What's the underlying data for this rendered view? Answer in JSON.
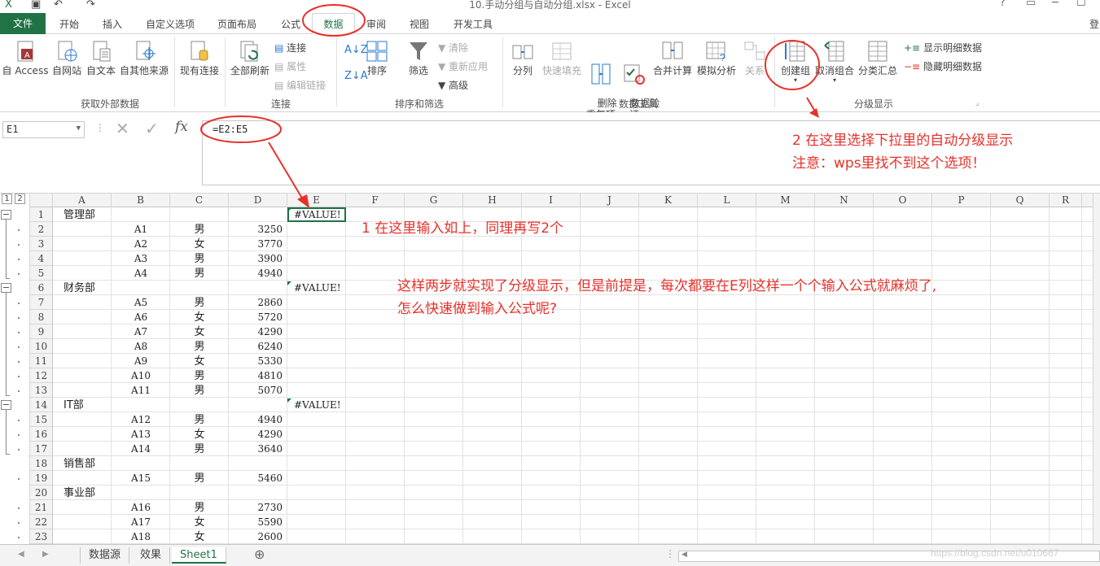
{
  "window": {
    "title": "10.手动分组与自动分组.xlsx - Excel",
    "signin": "登"
  },
  "tabs": {
    "file": "文件",
    "items": [
      "开始",
      "插入",
      "自定义选项",
      "页面布局",
      "公式",
      "数据",
      "审阅",
      "视图",
      "开发工具"
    ],
    "active": "数据"
  },
  "ribbon": {
    "external_data": {
      "buttons": [
        "自 Access",
        "自网站",
        "自文本",
        "自其他来源",
        "现有连接"
      ],
      "label": "获取外部数据"
    },
    "connections": {
      "refresh_all": "全部刷新",
      "small": [
        "连接",
        "属性",
        "编辑链接"
      ],
      "label": "连接"
    },
    "sort_filter": {
      "sort": "排序",
      "filter": "筛选",
      "small": [
        "清除",
        "重新应用",
        "高级"
      ],
      "label": "排序和筛选"
    },
    "data_tools": {
      "buttons": [
        "分列",
        "快速填充",
        "删除\n重复项",
        "数据验\n证",
        "合并计算",
        "模拟分析",
        "关系"
      ],
      "label": "数据工具"
    },
    "outline": {
      "buttons": [
        "创建组",
        "取消组合",
        "分类汇总"
      ],
      "small": [
        "显示明细数据",
        "隐藏明细数据"
      ],
      "label": "分级显示"
    }
  },
  "formula_bar": {
    "name_box": "E1",
    "formula": "=E2:E5",
    "fx": "fx"
  },
  "outline_levels": [
    "1",
    "2"
  ],
  "columns": [
    "A",
    "B",
    "C",
    "D",
    "E",
    "F",
    "G",
    "H",
    "I",
    "J",
    "K",
    "L",
    "M",
    "N",
    "O",
    "P",
    "Q",
    "R"
  ],
  "rows": [
    {
      "n": "1",
      "a": "管理部",
      "b": "",
      "c": "",
      "d": "",
      "e": "#VALUE!"
    },
    {
      "n": "2",
      "a": "",
      "b": "A1",
      "c": "男",
      "d": "3250",
      "e": ""
    },
    {
      "n": "3",
      "a": "",
      "b": "A2",
      "c": "女",
      "d": "3770",
      "e": ""
    },
    {
      "n": "4",
      "a": "",
      "b": "A3",
      "c": "男",
      "d": "3900",
      "e": ""
    },
    {
      "n": "5",
      "a": "",
      "b": "A4",
      "c": "男",
      "d": "4940",
      "e": ""
    },
    {
      "n": "6",
      "a": "财务部",
      "b": "",
      "c": "",
      "d": "",
      "e": "#VALUE!"
    },
    {
      "n": "7",
      "a": "",
      "b": "A5",
      "c": "男",
      "d": "2860",
      "e": ""
    },
    {
      "n": "8",
      "a": "",
      "b": "A6",
      "c": "女",
      "d": "5720",
      "e": ""
    },
    {
      "n": "9",
      "a": "",
      "b": "A7",
      "c": "女",
      "d": "4290",
      "e": ""
    },
    {
      "n": "10",
      "a": "",
      "b": "A8",
      "c": "男",
      "d": "6240",
      "e": ""
    },
    {
      "n": "11",
      "a": "",
      "b": "A9",
      "c": "女",
      "d": "5330",
      "e": ""
    },
    {
      "n": "12",
      "a": "",
      "b": "A10",
      "c": "男",
      "d": "4810",
      "e": ""
    },
    {
      "n": "13",
      "a": "",
      "b": "A11",
      "c": "男",
      "d": "5070",
      "e": ""
    },
    {
      "n": "14",
      "a": "IT部",
      "b": "",
      "c": "",
      "d": "",
      "e": "#VALUE!"
    },
    {
      "n": "15",
      "a": "",
      "b": "A12",
      "c": "男",
      "d": "4940",
      "e": ""
    },
    {
      "n": "16",
      "a": "",
      "b": "A13",
      "c": "女",
      "d": "4290",
      "e": ""
    },
    {
      "n": "17",
      "a": "",
      "b": "A14",
      "c": "男",
      "d": "3640",
      "e": ""
    },
    {
      "n": "18",
      "a": "销售部",
      "b": "",
      "c": "",
      "d": "",
      "e": ""
    },
    {
      "n": "19",
      "a": "",
      "b": "A15",
      "c": "男",
      "d": "5460",
      "e": ""
    },
    {
      "n": "20",
      "a": "事业部",
      "b": "",
      "c": "",
      "d": "",
      "e": ""
    },
    {
      "n": "21",
      "a": "",
      "b": "A16",
      "c": "男",
      "d": "2730",
      "e": ""
    },
    {
      "n": "22",
      "a": "",
      "b": "A17",
      "c": "女",
      "d": "5590",
      "e": ""
    },
    {
      "n": "23",
      "a": "",
      "b": "A18",
      "c": "女",
      "d": "2600",
      "e": ""
    }
  ],
  "sheet_tabs": [
    "数据源",
    "效果",
    "Sheet1"
  ],
  "active_sheet": "Sheet1",
  "annotations": {
    "step2_line1": "2 在这里选择下拉里的自动分级显示",
    "step2_line2": "注意：wps里找不到这个选项！",
    "step1": "1 在这里输入如上，同理再写2个",
    "note_line1": "这样两步就实现了分级显示，但是前提是，每次都要在E列这样一个个输入公式就麻烦了,",
    "note_line2": "怎么快速做到输入公式呢?"
  },
  "watermark": "https://blog.csdn.net/u010667",
  "colors": {
    "excel_green": "#217346",
    "annotation_red": "#e8312a"
  }
}
